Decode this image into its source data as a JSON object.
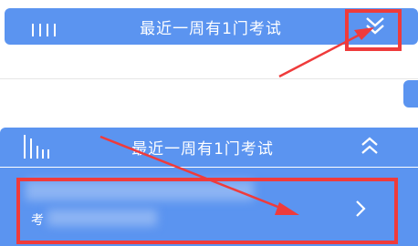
{
  "top_bar": {
    "title": "最近一周有1门考试",
    "menu_icon": "bars-icon",
    "toggle_icon": "double-chevron-down-icon"
  },
  "mid_bar": {
    "title": "最近一周有1门考试",
    "menu_icon": "bars-icon",
    "toggle_icon": "chevron-up-icon"
  },
  "exam_item": {
    "prefix": "考",
    "arrow_icon": "chevron-right-icon"
  },
  "annotations": {
    "highlight_color": "#ef3b3b",
    "arrow_color": "#ef3b3b"
  },
  "colors": {
    "bar": "#5b94f0",
    "text": "#ffffff"
  }
}
